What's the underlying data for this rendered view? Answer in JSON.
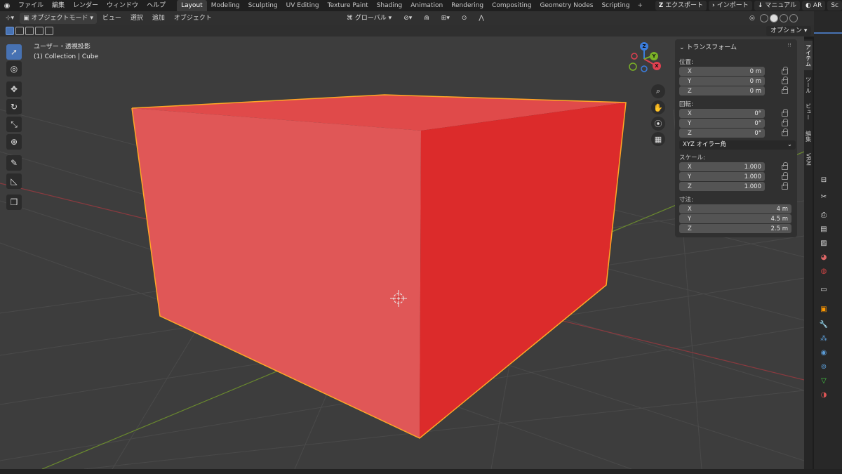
{
  "menu": {
    "items": [
      "ファイル",
      "編集",
      "レンダー",
      "ウィンドウ",
      "ヘルプ"
    ]
  },
  "workspaces": {
    "tabs": [
      "Layout",
      "Modeling",
      "Sculpting",
      "UV Editing",
      "Texture Paint",
      "Shading",
      "Animation",
      "Rendering",
      "Compositing",
      "Geometry Nodes",
      "Scripting"
    ],
    "active": "Layout"
  },
  "topright": {
    "export_label": "エクスポート",
    "import_label": "インポート",
    "manual_label": "マニュアル",
    "ar_label": "AR",
    "scene_label": "Sc"
  },
  "header": {
    "mode_label": "オブジェクトモード",
    "view_label": "ビュー",
    "select_label": "選択",
    "add_label": "追加",
    "object_label": "オブジェクト",
    "orientation_label": "グローバル",
    "options_label": "オプション"
  },
  "viewport": {
    "view_name": "ユーザー・透視投影",
    "collection_info": "(1) Collection | Cube"
  },
  "gizmo": {
    "x": "X",
    "y": "Y",
    "z": "Z"
  },
  "npanel": {
    "title": "トランスフォーム",
    "location_label": "位置:",
    "location": [
      {
        "axis": "X",
        "value": "0 m"
      },
      {
        "axis": "Y",
        "value": "0 m"
      },
      {
        "axis": "Z",
        "value": "0 m"
      }
    ],
    "rotation_label": "回転:",
    "rotation": [
      {
        "axis": "X",
        "value": "0°"
      },
      {
        "axis": "Y",
        "value": "0°"
      },
      {
        "axis": "Z",
        "value": "0°"
      }
    ],
    "rotation_mode": "XYZ オイラー角",
    "scale_label": "スケール:",
    "scale": [
      {
        "axis": "X",
        "value": "1.000"
      },
      {
        "axis": "Y",
        "value": "1.000"
      },
      {
        "axis": "Z",
        "value": "1.000"
      }
    ],
    "dimensions_label": "寸法:",
    "dimensions": [
      {
        "axis": "X",
        "value": "4 m"
      },
      {
        "axis": "Y",
        "value": "4.5 m"
      },
      {
        "axis": "Z",
        "value": "2.5 m"
      }
    ]
  },
  "sidetabs": [
    "アイテム",
    "ツール",
    "ビュー",
    "編集",
    "VRM"
  ],
  "colors": {
    "cube_front": "#e05757",
    "cube_side": "#dc2b2b",
    "cube_top": "#e04a4a",
    "selection_outline": "#ffa726",
    "accent": "#4772b3",
    "viewport_bg": "#3d3d3d"
  }
}
